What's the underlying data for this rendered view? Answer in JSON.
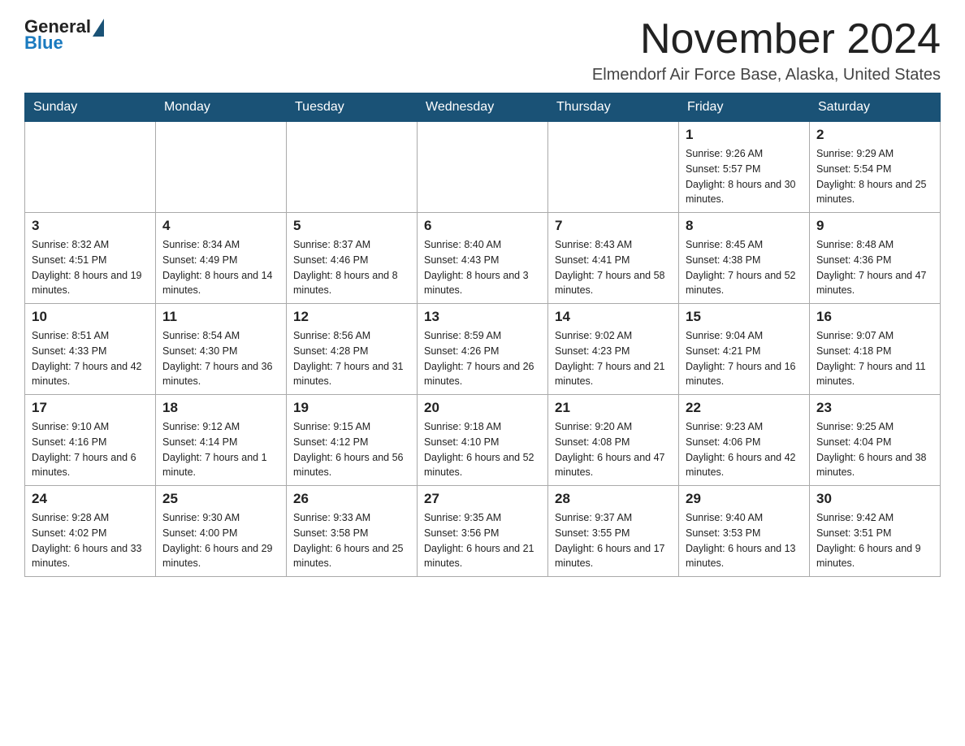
{
  "header": {
    "logo": {
      "general": "General",
      "blue": "Blue"
    },
    "title": "November 2024",
    "location": "Elmendorf Air Force Base, Alaska, United States"
  },
  "weekdays": [
    "Sunday",
    "Monday",
    "Tuesday",
    "Wednesday",
    "Thursday",
    "Friday",
    "Saturday"
  ],
  "weeks": [
    [
      {
        "day": "",
        "sunrise": "",
        "sunset": "",
        "daylight": ""
      },
      {
        "day": "",
        "sunrise": "",
        "sunset": "",
        "daylight": ""
      },
      {
        "day": "",
        "sunrise": "",
        "sunset": "",
        "daylight": ""
      },
      {
        "day": "",
        "sunrise": "",
        "sunset": "",
        "daylight": ""
      },
      {
        "day": "",
        "sunrise": "",
        "sunset": "",
        "daylight": ""
      },
      {
        "day": "1",
        "sunrise": "Sunrise: 9:26 AM",
        "sunset": "Sunset: 5:57 PM",
        "daylight": "Daylight: 8 hours and 30 minutes."
      },
      {
        "day": "2",
        "sunrise": "Sunrise: 9:29 AM",
        "sunset": "Sunset: 5:54 PM",
        "daylight": "Daylight: 8 hours and 25 minutes."
      }
    ],
    [
      {
        "day": "3",
        "sunrise": "Sunrise: 8:32 AM",
        "sunset": "Sunset: 4:51 PM",
        "daylight": "Daylight: 8 hours and 19 minutes."
      },
      {
        "day": "4",
        "sunrise": "Sunrise: 8:34 AM",
        "sunset": "Sunset: 4:49 PM",
        "daylight": "Daylight: 8 hours and 14 minutes."
      },
      {
        "day": "5",
        "sunrise": "Sunrise: 8:37 AM",
        "sunset": "Sunset: 4:46 PM",
        "daylight": "Daylight: 8 hours and 8 minutes."
      },
      {
        "day": "6",
        "sunrise": "Sunrise: 8:40 AM",
        "sunset": "Sunset: 4:43 PM",
        "daylight": "Daylight: 8 hours and 3 minutes."
      },
      {
        "day": "7",
        "sunrise": "Sunrise: 8:43 AM",
        "sunset": "Sunset: 4:41 PM",
        "daylight": "Daylight: 7 hours and 58 minutes."
      },
      {
        "day": "8",
        "sunrise": "Sunrise: 8:45 AM",
        "sunset": "Sunset: 4:38 PM",
        "daylight": "Daylight: 7 hours and 52 minutes."
      },
      {
        "day": "9",
        "sunrise": "Sunrise: 8:48 AM",
        "sunset": "Sunset: 4:36 PM",
        "daylight": "Daylight: 7 hours and 47 minutes."
      }
    ],
    [
      {
        "day": "10",
        "sunrise": "Sunrise: 8:51 AM",
        "sunset": "Sunset: 4:33 PM",
        "daylight": "Daylight: 7 hours and 42 minutes."
      },
      {
        "day": "11",
        "sunrise": "Sunrise: 8:54 AM",
        "sunset": "Sunset: 4:30 PM",
        "daylight": "Daylight: 7 hours and 36 minutes."
      },
      {
        "day": "12",
        "sunrise": "Sunrise: 8:56 AM",
        "sunset": "Sunset: 4:28 PM",
        "daylight": "Daylight: 7 hours and 31 minutes."
      },
      {
        "day": "13",
        "sunrise": "Sunrise: 8:59 AM",
        "sunset": "Sunset: 4:26 PM",
        "daylight": "Daylight: 7 hours and 26 minutes."
      },
      {
        "day": "14",
        "sunrise": "Sunrise: 9:02 AM",
        "sunset": "Sunset: 4:23 PM",
        "daylight": "Daylight: 7 hours and 21 minutes."
      },
      {
        "day": "15",
        "sunrise": "Sunrise: 9:04 AM",
        "sunset": "Sunset: 4:21 PM",
        "daylight": "Daylight: 7 hours and 16 minutes."
      },
      {
        "day": "16",
        "sunrise": "Sunrise: 9:07 AM",
        "sunset": "Sunset: 4:18 PM",
        "daylight": "Daylight: 7 hours and 11 minutes."
      }
    ],
    [
      {
        "day": "17",
        "sunrise": "Sunrise: 9:10 AM",
        "sunset": "Sunset: 4:16 PM",
        "daylight": "Daylight: 7 hours and 6 minutes."
      },
      {
        "day": "18",
        "sunrise": "Sunrise: 9:12 AM",
        "sunset": "Sunset: 4:14 PM",
        "daylight": "Daylight: 7 hours and 1 minute."
      },
      {
        "day": "19",
        "sunrise": "Sunrise: 9:15 AM",
        "sunset": "Sunset: 4:12 PM",
        "daylight": "Daylight: 6 hours and 56 minutes."
      },
      {
        "day": "20",
        "sunrise": "Sunrise: 9:18 AM",
        "sunset": "Sunset: 4:10 PM",
        "daylight": "Daylight: 6 hours and 52 minutes."
      },
      {
        "day": "21",
        "sunrise": "Sunrise: 9:20 AM",
        "sunset": "Sunset: 4:08 PM",
        "daylight": "Daylight: 6 hours and 47 minutes."
      },
      {
        "day": "22",
        "sunrise": "Sunrise: 9:23 AM",
        "sunset": "Sunset: 4:06 PM",
        "daylight": "Daylight: 6 hours and 42 minutes."
      },
      {
        "day": "23",
        "sunrise": "Sunrise: 9:25 AM",
        "sunset": "Sunset: 4:04 PM",
        "daylight": "Daylight: 6 hours and 38 minutes."
      }
    ],
    [
      {
        "day": "24",
        "sunrise": "Sunrise: 9:28 AM",
        "sunset": "Sunset: 4:02 PM",
        "daylight": "Daylight: 6 hours and 33 minutes."
      },
      {
        "day": "25",
        "sunrise": "Sunrise: 9:30 AM",
        "sunset": "Sunset: 4:00 PM",
        "daylight": "Daylight: 6 hours and 29 minutes."
      },
      {
        "day": "26",
        "sunrise": "Sunrise: 9:33 AM",
        "sunset": "Sunset: 3:58 PM",
        "daylight": "Daylight: 6 hours and 25 minutes."
      },
      {
        "day": "27",
        "sunrise": "Sunrise: 9:35 AM",
        "sunset": "Sunset: 3:56 PM",
        "daylight": "Daylight: 6 hours and 21 minutes."
      },
      {
        "day": "28",
        "sunrise": "Sunrise: 9:37 AM",
        "sunset": "Sunset: 3:55 PM",
        "daylight": "Daylight: 6 hours and 17 minutes."
      },
      {
        "day": "29",
        "sunrise": "Sunrise: 9:40 AM",
        "sunset": "Sunset: 3:53 PM",
        "daylight": "Daylight: 6 hours and 13 minutes."
      },
      {
        "day": "30",
        "sunrise": "Sunrise: 9:42 AM",
        "sunset": "Sunset: 3:51 PM",
        "daylight": "Daylight: 6 hours and 9 minutes."
      }
    ]
  ]
}
